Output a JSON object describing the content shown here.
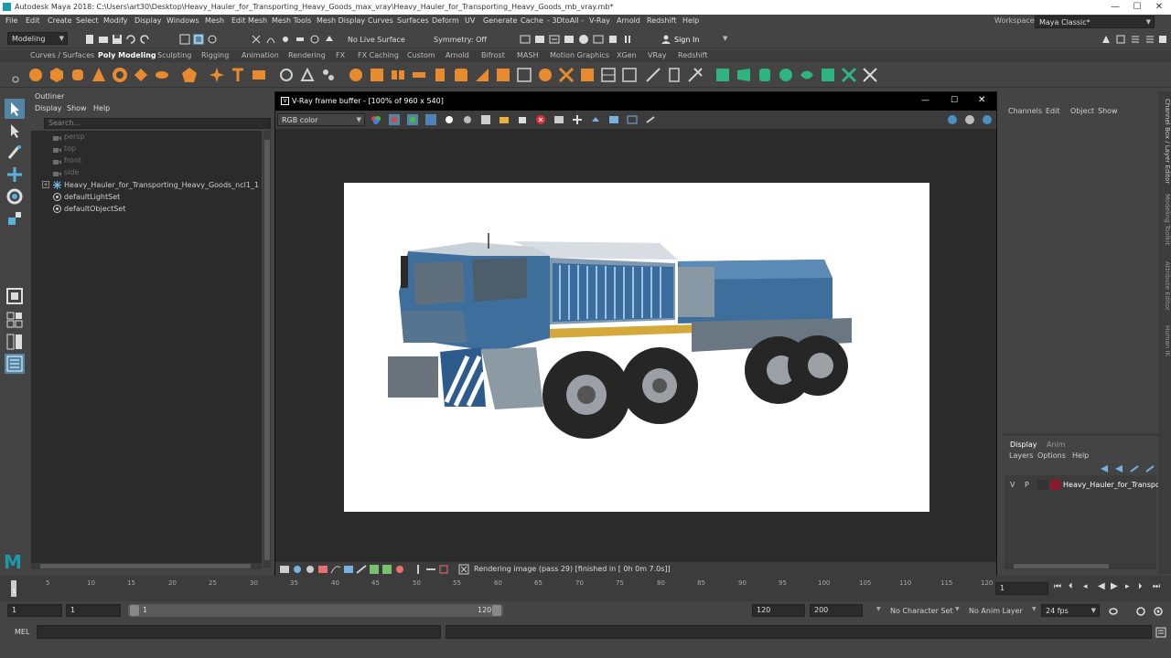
{
  "titlebar": {
    "title": "Autodesk Maya 2018: C:\\Users\\art30\\Desktop\\Heavy_Hauler_for_Transporting_Heavy_Goods_max_vray\\Heavy_Hauler_for_Transporting_Heavy_Goods_mb_vray.mb*",
    "minimize": "—",
    "maximize": "☐",
    "close": "✕"
  },
  "menubar": {
    "items": [
      "File",
      "Edit",
      "Create",
      "Select",
      "Modify",
      "Display",
      "Windows",
      "Mesh",
      "Edit Mesh",
      "Mesh Tools",
      "Mesh Display",
      "Curves",
      "Surfaces",
      "Deform",
      "UV",
      "Generate",
      "Cache",
      "- 3DtoAll -",
      "V-Ray",
      "Arnold",
      "Redshift",
      "Help"
    ],
    "workspace_label": "Workspace :",
    "workspace_value": "Maya Classic*"
  },
  "statusline": {
    "mode": "Modeling",
    "live_surface": "No Live Surface",
    "symmetry": "Symmetry: Off",
    "sign_in": "Sign In"
  },
  "shelf": {
    "tabs": [
      "Curves / Surfaces",
      "Poly Modeling",
      "Sculpting",
      "Rigging",
      "Animation",
      "Rendering",
      "FX",
      "FX Caching",
      "Custom",
      "Arnold",
      "Bifrost",
      "MASH",
      "Motion Graphics",
      "XGen",
      "VRay",
      "Redshift"
    ],
    "active_tab": "Poly Modeling"
  },
  "outliner": {
    "title": "Outliner",
    "menus": [
      "Display",
      "Show",
      "Help"
    ],
    "search_placeholder": "Search...",
    "items": [
      {
        "label": "persp",
        "type": "camera",
        "dim": true
      },
      {
        "label": "top",
        "type": "camera",
        "dim": true
      },
      {
        "label": "front",
        "type": "camera",
        "dim": true
      },
      {
        "label": "side",
        "type": "camera",
        "dim": true
      },
      {
        "label": "Heavy_Hauler_for_Transporting_Heavy_Goods_ncl1_1",
        "type": "group",
        "dim": false
      },
      {
        "label": "defaultLightSet",
        "type": "set",
        "dim": false
      },
      {
        "label": "defaultObjectSet",
        "type": "set",
        "dim": false
      }
    ]
  },
  "vfb": {
    "title": "V-Ray frame buffer - [100% of 960 x 540]",
    "channel": "RGB color",
    "status": "Rendering image (pass 29) [finished in [ 0h  0m  7.0s]]"
  },
  "channelbox": {
    "menus": [
      "Channels",
      "Edit",
      "Object",
      "Show"
    ],
    "display_tabs": [
      "Display",
      "Anim"
    ],
    "active_display_tab": "Display",
    "layer_menus": [
      "Layers",
      "Options",
      "Help"
    ],
    "layer": {
      "v": "V",
      "p": "P",
      "name": "Heavy_Hauler_for_Transporting",
      "color": "#8a1a2a"
    }
  },
  "sidetabs": [
    "Channel Box / Layer Editor",
    "Modeling Toolkit",
    "Attribute Editor",
    "Human IK"
  ],
  "timeslider": {
    "ticks": [
      "1",
      "5",
      "10",
      "15",
      "20",
      "25",
      "30",
      "35",
      "40",
      "45",
      "50",
      "55",
      "60",
      "65",
      "70",
      "75",
      "80",
      "85",
      "90",
      "95",
      "100",
      "105",
      "110",
      "115",
      "120"
    ],
    "current_frame": "1"
  },
  "rangeslider": {
    "start": "1",
    "playback_start": "1",
    "range_start_label": "1",
    "range_end_label": "120",
    "playback_end": "120",
    "end": "200",
    "character_set": "No Character Set",
    "anim_layer": "No Anim Layer",
    "fps": "24 fps"
  },
  "cmdline": {
    "lang": "MEL"
  },
  "colors": {
    "accent": "#5285a6",
    "panel": "#444444",
    "field": "#2b2b2b",
    "vfb_title": "#000000"
  }
}
